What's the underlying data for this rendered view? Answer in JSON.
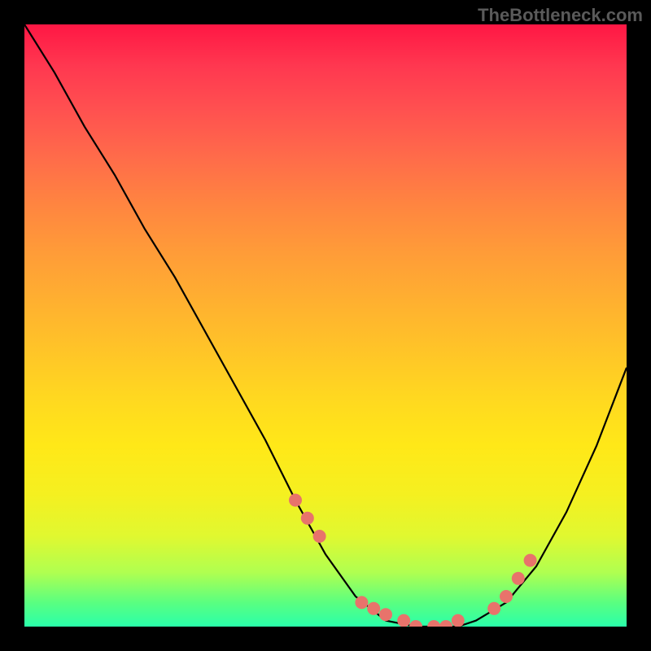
{
  "watermark": "TheBottleneck.com",
  "chart_data": {
    "type": "line",
    "title": "",
    "xlabel": "",
    "ylabel": "",
    "xlim": [
      0,
      100
    ],
    "ylim": [
      0,
      100
    ],
    "curve": {
      "x": [
        0,
        5,
        10,
        15,
        20,
        25,
        30,
        35,
        40,
        45,
        50,
        55,
        60,
        65,
        70,
        72,
        75,
        80,
        85,
        90,
        95,
        100
      ],
      "y": [
        100,
        92,
        83,
        75,
        66,
        58,
        49,
        40,
        31,
        21,
        12,
        5,
        1,
        0,
        0,
        0,
        1,
        4,
        10,
        19,
        30,
        43
      ]
    },
    "markers": {
      "x": [
        45,
        47,
        49,
        56,
        58,
        60,
        63,
        65,
        68,
        70,
        72,
        78,
        80,
        82,
        84
      ],
      "y": [
        21,
        18,
        15,
        4,
        3,
        2,
        1,
        0,
        0,
        0,
        1,
        3,
        5,
        8,
        11
      ]
    },
    "marker_color": "#e8736b",
    "curve_color": "#000000"
  }
}
